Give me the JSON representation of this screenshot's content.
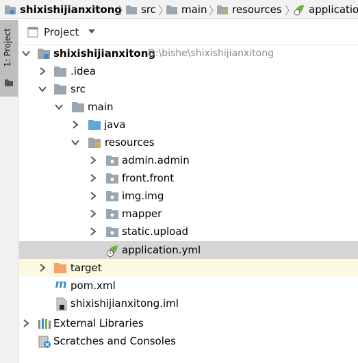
{
  "breadcrumb": {
    "items": [
      {
        "label": "shixishijianxitong",
        "icon": "module-folder-icon"
      },
      {
        "label": "src",
        "icon": "folder-icon"
      },
      {
        "label": "main",
        "icon": "folder-icon"
      },
      {
        "label": "resources",
        "icon": "resources-folder-icon"
      },
      {
        "label": "application",
        "icon": "spring-leaf-icon"
      }
    ]
  },
  "side_tool": {
    "label": "1: Project"
  },
  "panel": {
    "title": "Project"
  },
  "tree": {
    "root": {
      "label": "shixishijianxitong",
      "path": "D:\\bishe\\shixishijianxitong"
    },
    "idea": "idea",
    "src": "src",
    "main": "main",
    "java": "java",
    "resources": "resources",
    "admin": "admin.admin",
    "front": "front.front",
    "img": "img.img",
    "mapper": "mapper",
    "static": "static.upload",
    "application": "application.yml",
    "target": "target",
    "pom": "pom.xml",
    "iml": "shixishijianxitong.iml",
    "external": "External Libraries",
    "scratches": "Scratches and Consoles"
  },
  "colors": {
    "folder": "#9aa7b0",
    "java_folder": "#5ea8d8",
    "target_folder": "#f4a26b",
    "spring": "#6db33f",
    "selected_row": "#d5d5d5",
    "excluded_row": "#fdf8e1"
  }
}
